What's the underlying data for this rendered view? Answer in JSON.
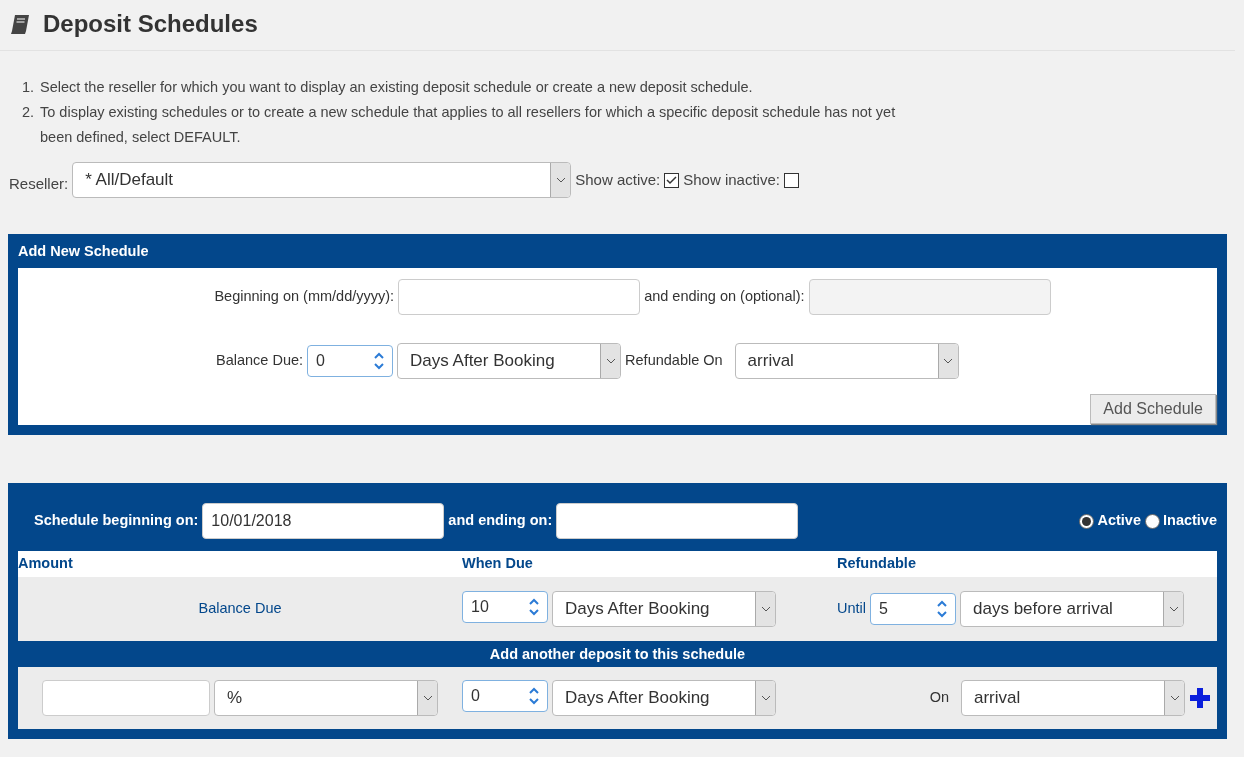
{
  "title": "Deposit Schedules",
  "instructions": [
    {
      "number": "1.",
      "text": "Select the reseller for which you want to display an existing deposit schedule or create a new deposit schedule."
    },
    {
      "number": "2.",
      "text": "To display existing schedules or to create a new schedule that applies to all resellers for which a specific deposit schedule has not yet been defined, select DEFAULT."
    }
  ],
  "filter": {
    "label": "Reseller:",
    "value": "* All/Default",
    "show_active": {
      "label": "Show active:",
      "checked": true
    },
    "show_inactive": {
      "label": "Show inactive:",
      "checked": false
    }
  },
  "add_panel": {
    "title": "Add New Schedule",
    "begin_label": "Beginning on (mm/dd/yyyy):",
    "end_label": "and ending on (optional):",
    "end_disabled": true,
    "balance_label": "Balance Due:",
    "balance_value": "0",
    "balance_unit": "Days After Booking",
    "refund_label": "Refundable On",
    "refund_value": "arrival",
    "button": "Add Schedule"
  },
  "schedule": {
    "begin_label": "Schedule beginning on:",
    "begin_value": "10/01/2018",
    "end_label": "and ending on:",
    "status": [
      {
        "label": "Active",
        "selected": true
      },
      {
        "label": "Inactive",
        "selected": false
      }
    ],
    "columns": [
      "Amount",
      "When Due",
      "Refundable"
    ],
    "row": {
      "amount": "Balance Due",
      "due_value": "10",
      "due_unit": "Days After Booking",
      "until_label": "Until",
      "refund_value": "5",
      "refund_unit": "days before arrival"
    },
    "add_title": "Add another deposit to this schedule",
    "add_row": {
      "amount_unit": "%",
      "due_value": "0",
      "due_unit": "Days After Booking",
      "on_label": "On",
      "on_value": "arrival"
    }
  }
}
